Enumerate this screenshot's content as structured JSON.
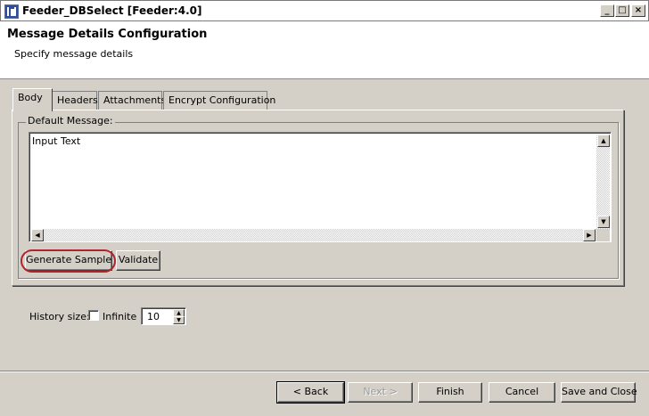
{
  "window": {
    "title": "Feeder_DBSelect [Feeder:4.0]",
    "minimize_glyph": "_",
    "maximize_glyph": "□",
    "close_glyph": "×"
  },
  "header": {
    "title": "Message Details Configuration",
    "subtitle": "Specify message details"
  },
  "tabs": [
    {
      "label": "Body",
      "active": true
    },
    {
      "label": "Headers",
      "active": false
    },
    {
      "label": "Attachments",
      "active": false
    },
    {
      "label": "Encrypt Configuration",
      "active": false
    }
  ],
  "body": {
    "group_label": "Default Message:",
    "message_text": "Input Text",
    "generate_sample_label": "Generate Sample",
    "validate_label": "Validate"
  },
  "history": {
    "label": "History size:",
    "infinite_label": "Infinite",
    "infinite_checked": false,
    "size_value": "10"
  },
  "footer": {
    "back_label": "< Back",
    "next_label": "Next >",
    "finish_label": "Finish",
    "cancel_label": "Cancel",
    "save_close_label": "Save and Close"
  },
  "colors": {
    "highlight_annotation": "#b0242b",
    "dialog_background": "#d4d0c8",
    "header_background": "#ffffff"
  },
  "icons": {
    "app": "feeder-app-icon",
    "scroll_up": "arrow-up-icon",
    "scroll_down": "arrow-down-icon",
    "scroll_left": "arrow-left-icon",
    "scroll_right": "arrow-right-icon"
  }
}
